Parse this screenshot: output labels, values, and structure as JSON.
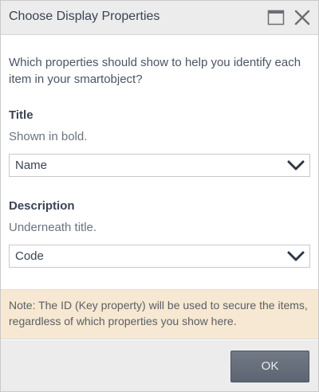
{
  "dialog": {
    "title": "Choose Display Properties",
    "intro": "Which properties should show to help you identify each item in your smartobject?",
    "title_field": {
      "heading": "Title",
      "hint": "Shown in bold.",
      "selected": "Name"
    },
    "description_field": {
      "heading": "Description",
      "hint": "Underneath title.",
      "selected": "Code"
    },
    "note": "Note: The ID (Key property) will be used to secure the items, regardless of which properties you show here.",
    "ok_label": "OK"
  },
  "icons": {
    "maximize": "maximize-icon",
    "close": "close-icon",
    "dropdown": "chevron-down-icon"
  },
  "colors": {
    "titlebar_bg": "#ececec",
    "note_bg": "#f6e8d2",
    "ok_button_bg": "#656d79",
    "text": "#3a4453"
  }
}
